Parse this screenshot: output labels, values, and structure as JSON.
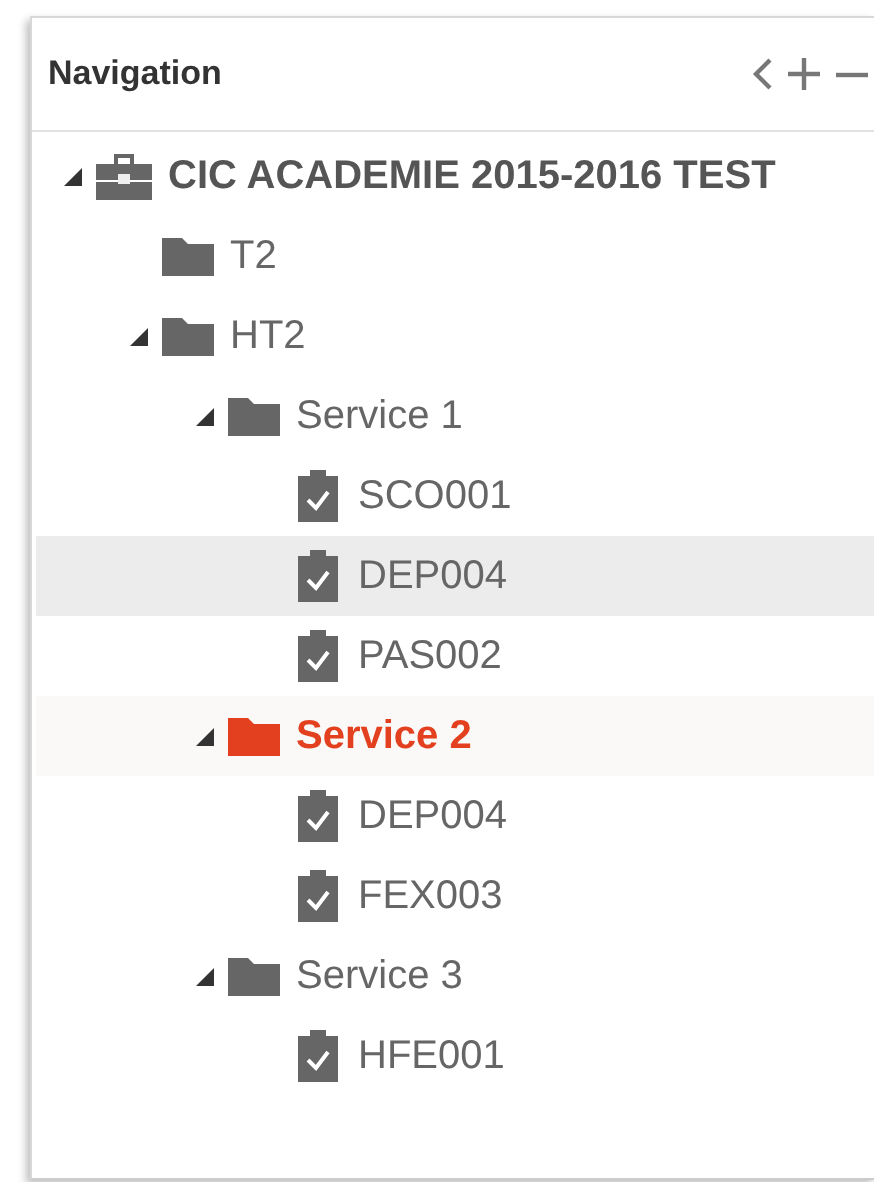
{
  "panel": {
    "title": "Navigation",
    "tools": [
      {
        "kind": "back"
      },
      {
        "kind": "add"
      },
      {
        "kind": "remove"
      }
    ]
  },
  "tree": [
    {
      "kind": "root",
      "label": "CIC ACADEMIE 2015-2016 TEST",
      "expanded": true,
      "selected": false,
      "highlighted": false,
      "children": [
        {
          "kind": "folder",
          "label": "T2",
          "selected": false,
          "highlighted": false
        },
        {
          "kind": "folder",
          "label": "HT2",
          "expanded": true,
          "selected": false,
          "highlighted": false,
          "children": [
            {
              "kind": "folder",
              "label": "Service 1",
              "expanded": true,
              "selected": false,
              "highlighted": false,
              "children": [
                {
                  "kind": "task",
                  "label": "SCO001",
                  "selected": false,
                  "highlighted": false
                },
                {
                  "kind": "task",
                  "label": "DEP004",
                  "selected": false,
                  "highlighted": true
                },
                {
                  "kind": "task",
                  "label": "PAS002",
                  "selected": false,
                  "highlighted": false
                }
              ]
            },
            {
              "kind": "folder",
              "label": "Service 2",
              "expanded": true,
              "selected": true,
              "highlighted": false,
              "children": [
                {
                  "kind": "task",
                  "label": "DEP004",
                  "selected": false,
                  "highlighted": false
                },
                {
                  "kind": "task",
                  "label": "FEX003",
                  "selected": false,
                  "highlighted": false
                }
              ]
            },
            {
              "kind": "folder",
              "label": "Service 3",
              "expanded": true,
              "selected": false,
              "highlighted": false,
              "children": [
                {
                  "kind": "task",
                  "label": "HFE001",
                  "selected": false,
                  "highlighted": false
                }
              ]
            }
          ]
        }
      ]
    }
  ]
}
